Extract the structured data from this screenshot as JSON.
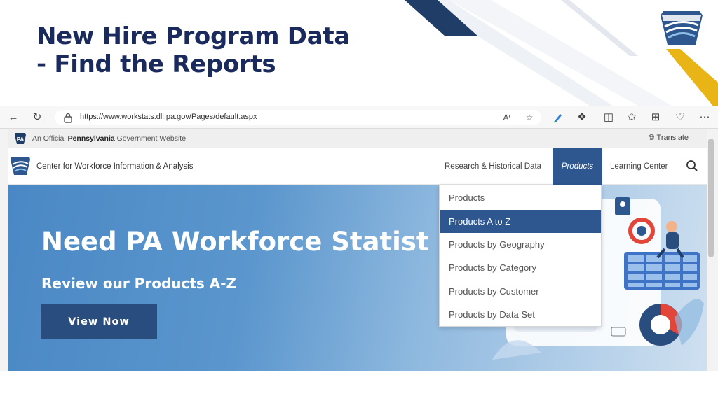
{
  "slide": {
    "title_line1": "New Hire Program Data",
    "title_line2": "- Find the Reports"
  },
  "colors": {
    "title": "#1b2a5c",
    "navy_stripe": "#1f3d66",
    "gold_stripe": "#e8b416",
    "accent_blue": "#2e5790",
    "hero_blue": "#4a88c5"
  },
  "browser": {
    "url": "https://www.workstats.dli.pa.gov/Pages/default.aspx",
    "icons": [
      "back-arrow-icon",
      "refresh-icon",
      "lock-icon",
      "read-aloud-icon",
      "favorite-star-icon",
      "pen-icon",
      "extensions-icon",
      "split-screen-icon",
      "favorites-icon",
      "collections-icon",
      "performance-icon",
      "more-icon"
    ]
  },
  "site": {
    "official_prefix": "An Official ",
    "official_bold": "Pennsylvania",
    "official_suffix": " Government Website",
    "translate": "Translate",
    "badge_text": "PA",
    "name": "Center for Workforce Information & Analysis",
    "nav": {
      "research": "Research & Historical Data",
      "products": "Products",
      "learning": "Learning Center"
    }
  },
  "dropdown": {
    "items": [
      {
        "label": "Products"
      },
      {
        "label": "Products A to Z"
      },
      {
        "label": "Products by Geography"
      },
      {
        "label": "Products by Category"
      },
      {
        "label": "Products by Customer"
      },
      {
        "label": "Products by Data Set"
      }
    ],
    "active_index": 1
  },
  "hero": {
    "title": "Need PA Workforce Statist",
    "subtitle": "Review our Products A-Z",
    "button": "View Now"
  }
}
